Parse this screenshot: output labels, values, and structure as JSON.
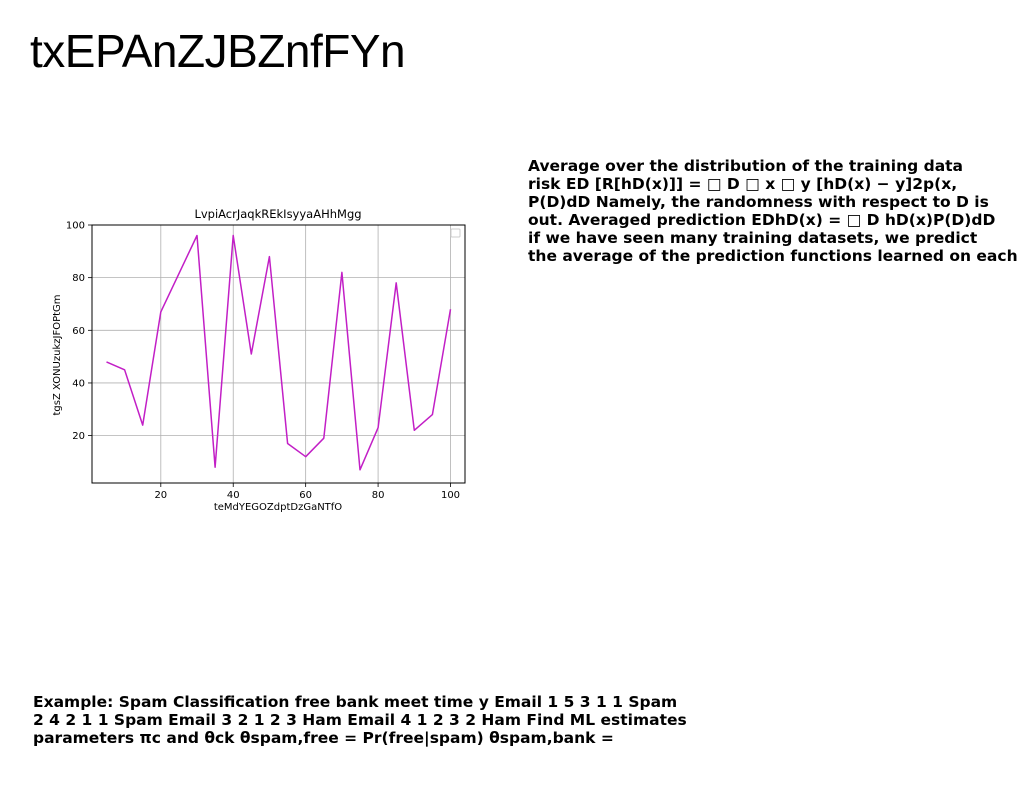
{
  "slide": {
    "title": "txEPAnZJBZnfFYn"
  },
  "right_text": {
    "lines": [
      "Average over the distribution of the training data",
      "risk ED [R[hD(x)]] = □ D □ x □ y [hD(x) − y]2p(x,",
      "P(D)dD Namely, the randomness with respect to D is",
      "out. Averaged prediction EDhD(x) = □ D hD(x)P(D)dD",
      "if we have seen many training datasets, we predict",
      "the average of the prediction functions learned on each"
    ]
  },
  "bottom_text": {
    "lines": [
      "Example: Spam Classification free bank meet time y Email 1 5 3 1 1 Spam",
      "2 4 2 1 1 Spam Email 3 2 1 2 3 Ham Email 4 1 2 3 2 Ham Find ML estimates",
      "parameters πc and θck θspam,free = Pr(free|spam) θspam,bank ="
    ]
  },
  "chart_data": {
    "type": "line",
    "title": "LvpiAcrJaqkREkIsyyaAHhMgg",
    "xlabel": "teMdYEGOZdptDzGaNTfO",
    "ylabel": "tgsZ XONUzukzJFOPtGm",
    "xlim": [
      1,
      104
    ],
    "ylim": [
      2,
      100
    ],
    "xticks": [
      20,
      40,
      60,
      80,
      100
    ],
    "yticks": [
      20,
      40,
      60,
      80,
      100
    ],
    "grid": true,
    "legend": "top-right",
    "series": [
      {
        "color": "#c21fc6",
        "x": [
          5,
          10,
          15,
          20,
          30,
          35,
          40,
          45,
          50,
          55,
          60,
          65,
          70,
          75,
          80,
          85,
          90,
          95,
          100
        ],
        "y": [
          48,
          45,
          24,
          67,
          96,
          8,
          96,
          51,
          88,
          17,
          12,
          19,
          82,
          7,
          23,
          78,
          22,
          28,
          68
        ]
      }
    ]
  }
}
